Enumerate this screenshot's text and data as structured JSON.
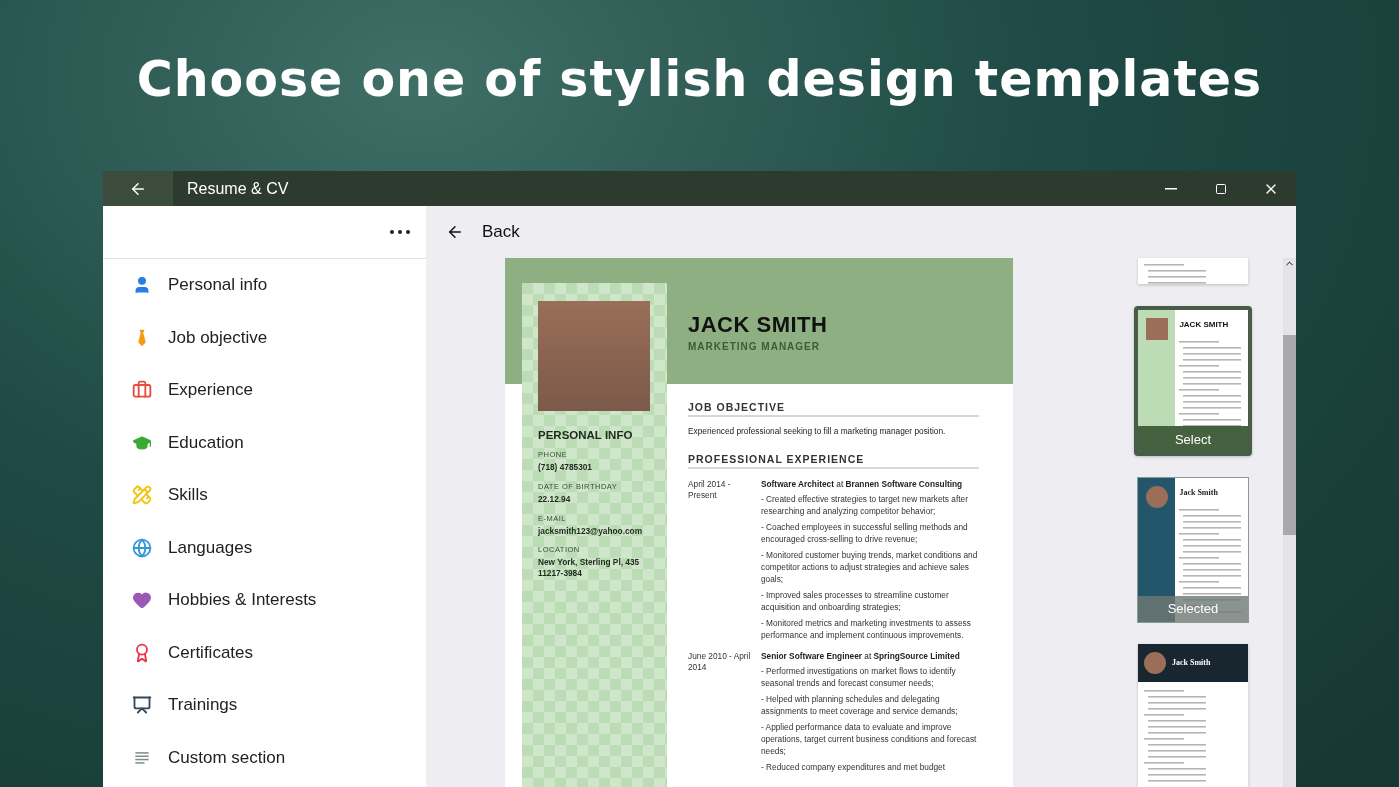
{
  "headline": "Choose one of stylish design templates",
  "window": {
    "title": "Resume & CV"
  },
  "sidebar": {
    "items": [
      {
        "label": "Personal info",
        "color": "#2a7de1"
      },
      {
        "label": "Job objective",
        "color": "#f39c12"
      },
      {
        "label": "Experience",
        "color": "#e74c3c"
      },
      {
        "label": "Education",
        "color": "#3aa935"
      },
      {
        "label": "Skills",
        "color": "#f1c40f"
      },
      {
        "label": "Languages",
        "color": "#3498db"
      },
      {
        "label": "Hobbies & Interests",
        "color": "#9b59b6"
      },
      {
        "label": "Certificates",
        "color": "#e8334a"
      },
      {
        "label": "Trainings",
        "color": "#34495e"
      },
      {
        "label": "Custom section",
        "color": "#7f8c8d"
      }
    ]
  },
  "back": "Back",
  "resume": {
    "name": "JACK SMITH",
    "title": "MARKETING MANAGER",
    "personal_heading": "PERSONAL INFO",
    "fields": [
      {
        "label": "PHONE",
        "value": "(718) 4785301"
      },
      {
        "label": "DATE OF BIRTHDAY",
        "value": "22.12.94"
      },
      {
        "label": "E-MAIL",
        "value": "jacksmith123@yahoo.com"
      },
      {
        "label": "LOCATION",
        "value": "New York, Sterling Pl, 435 11217-3984"
      }
    ],
    "objective_heading": "JOB OBJECTIVE",
    "objective": "Experienced professional seeking to fill a marketing manager position.",
    "experience_heading": "PROFESSIONAL EXPERIENCE",
    "jobs": [
      {
        "dates": "April 2014 - Present",
        "role": "**Software Architect** at **Brannen Software Consulting**",
        "bullets": [
          "- Created effective strategies to target new markets after researching and analyzing competitor behavior;",
          "- Coached employees in successful selling methods and encouraged cross-selling to drive revenue;",
          "- Monitored customer buying trends, market conditions and competitor actions to adjust strategies and achieve sales goals;",
          "- Improved sales processes to streamline customer acquisition and onboarding strategies;",
          "- Monitored metrics and marketing investments to assess performance and implement continuous improvements."
        ]
      },
      {
        "dates": "June 2010 - April 2014",
        "role": "**Senior Software Engineer** at **SpringSource Limited**",
        "bullets": [
          "- Performed investigations on market flows to identify seasonal trends and forecast consumer needs;",
          "- Helped with planning schedules and delegating assignments to meet coverage and service demands;",
          "- Applied performance data to evaluate and improve operations, target current business conditions and forecast needs;",
          "- Reduced company expenditures and met budget"
        ]
      }
    ]
  },
  "thumbnails": [
    {
      "kind": "partial",
      "selected": false,
      "hovered": false
    },
    {
      "kind": "green",
      "name": "JACK SMITH",
      "overlay": "Select",
      "selected": false,
      "hovered": true
    },
    {
      "kind": "blue",
      "name": "Jack Smith",
      "overlay": "Selected",
      "selected": true,
      "hovered": false
    },
    {
      "kind": "dark",
      "name": "Jack Smith",
      "selected": false,
      "hovered": false
    }
  ]
}
